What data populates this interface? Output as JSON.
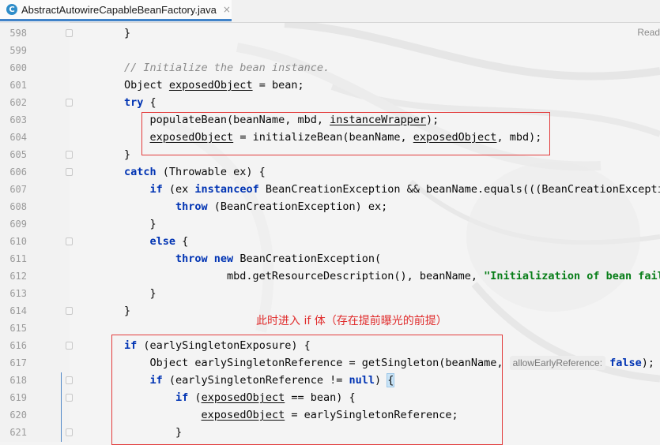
{
  "editor": {
    "tab": {
      "icon": "C",
      "file_name": "AbstractAutowireCapableBeanFactory.java",
      "close": "×"
    },
    "reader_mode_label": "Read"
  },
  "annotation": "此时进入 if 体（存在提前曝光的前提）",
  "lines": [
    {
      "n": "598",
      "fold": true,
      "tokens": [
        [
          "p",
          "}"
        ]
      ]
    },
    {
      "n": "599",
      "tokens": []
    },
    {
      "n": "600",
      "tokens": [
        [
          "cm",
          "// Initialize the bean instance."
        ]
      ]
    },
    {
      "n": "601",
      "tokens": [
        [
          "p",
          "Object "
        ],
        [
          "ul",
          "exposedObject"
        ],
        [
          "p",
          " = bean;"
        ]
      ]
    },
    {
      "n": "602",
      "fold": true,
      "tokens": [
        [
          "kw",
          "try"
        ],
        [
          "p",
          " {"
        ]
      ]
    },
    {
      "n": "603",
      "tokens": [
        [
          "p",
          "    populateBean(beanName, mbd, "
        ],
        [
          "ul",
          "instanceWrapper"
        ],
        [
          "p",
          ");"
        ]
      ]
    },
    {
      "n": "604",
      "tokens": [
        [
          "p",
          "    "
        ],
        [
          "ul",
          "exposedObject"
        ],
        [
          "p",
          " = initializeBean(beanName, "
        ],
        [
          "ul",
          "exposedObject"
        ],
        [
          "p",
          ", mbd);"
        ]
      ]
    },
    {
      "n": "605",
      "fold": true,
      "tokens": [
        [
          "p",
          "}"
        ]
      ]
    },
    {
      "n": "606",
      "fold": true,
      "tokens": [
        [
          "kw",
          "catch"
        ],
        [
          "p",
          " (Throwable ex) {"
        ]
      ]
    },
    {
      "n": "607",
      "tokens": [
        [
          "p",
          "    "
        ],
        [
          "kw",
          "if"
        ],
        [
          "p",
          " (ex "
        ],
        [
          "kw",
          "instanceof"
        ],
        [
          "p",
          " BeanCreationException && beanName.equals(((BeanCreationException"
        ]
      ]
    },
    {
      "n": "608",
      "tokens": [
        [
          "p",
          "        "
        ],
        [
          "kw",
          "throw"
        ],
        [
          "p",
          " (BeanCreationException) ex;"
        ]
      ]
    },
    {
      "n": "609",
      "tokens": [
        [
          "p",
          "    }"
        ]
      ]
    },
    {
      "n": "610",
      "fold": true,
      "tokens": [
        [
          "p",
          "    "
        ],
        [
          "kw",
          "else"
        ],
        [
          "p",
          " {"
        ]
      ]
    },
    {
      "n": "611",
      "tokens": [
        [
          "p",
          "        "
        ],
        [
          "kw",
          "throw new"
        ],
        [
          "p",
          " BeanCreationException("
        ]
      ]
    },
    {
      "n": "612",
      "tokens": [
        [
          "p",
          "                mbd.getResourceDescription(), beanName, "
        ],
        [
          "str",
          "\"Initialization of bean faile"
        ]
      ]
    },
    {
      "n": "613",
      "tokens": [
        [
          "p",
          "    }"
        ]
      ]
    },
    {
      "n": "614",
      "fold": true,
      "tokens": [
        [
          "p",
          "}"
        ]
      ]
    },
    {
      "n": "615",
      "tokens": []
    },
    {
      "n": "616",
      "fold": true,
      "tokens": [
        [
          "kw",
          "if"
        ],
        [
          "p",
          " (earlySingletonExposure) {"
        ]
      ]
    },
    {
      "n": "617",
      "tokens": [
        [
          "p",
          "    Object earlySingletonReference = getSingleton(beanName, "
        ],
        [
          "hint",
          "allowEarlyReference:"
        ],
        [
          "kw",
          "false"
        ],
        [
          "p",
          ");"
        ]
      ]
    },
    {
      "n": "618",
      "fold": true,
      "tokens": [
        [
          "p",
          "    "
        ],
        [
          "kw",
          "if"
        ],
        [
          "p",
          " (earlySingletonReference != "
        ],
        [
          "kw",
          "null"
        ],
        [
          "p",
          ") "
        ],
        [
          "brace",
          "{"
        ]
      ]
    },
    {
      "n": "619",
      "fold": true,
      "tokens": [
        [
          "p",
          "        "
        ],
        [
          "kw",
          "if"
        ],
        [
          "p",
          " ("
        ],
        [
          "ul",
          "exposedObject"
        ],
        [
          "p",
          " == bean) {"
        ]
      ]
    },
    {
      "n": "620",
      "tokens": [
        [
          "p",
          "            "
        ],
        [
          "ul",
          "exposedObject"
        ],
        [
          "p",
          " = earlySingletonReference;"
        ]
      ]
    },
    {
      "n": "621",
      "fold": true,
      "tokens": [
        [
          "p",
          "        }"
        ]
      ]
    }
  ]
}
